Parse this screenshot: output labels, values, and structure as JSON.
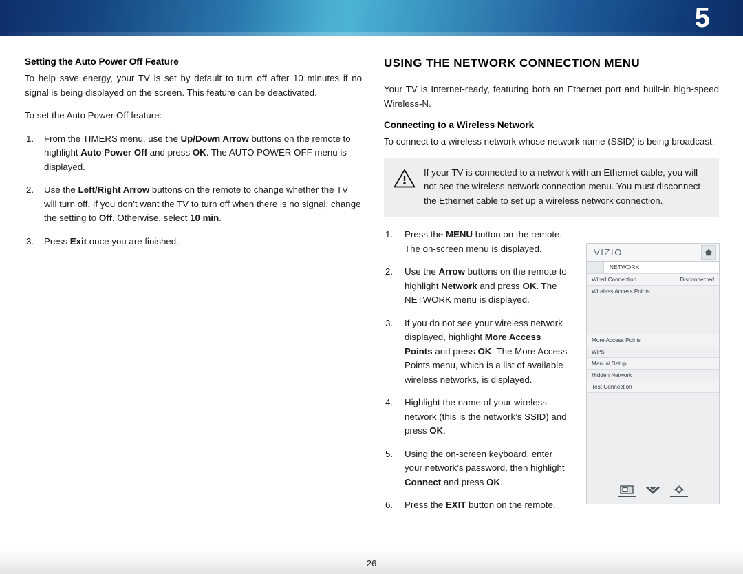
{
  "header": {
    "chapter_number": "5",
    "gradient_dark": "#0d2f6b",
    "gradient_light": "#4bb3d6"
  },
  "left_column": {
    "heading": "Setting the Auto Power Off Feature",
    "paragraph_1": "To help save energy, your TV is set by default to turn off after 10 minutes if no signal is being displayed on the screen. This feature can be deactivated.",
    "paragraph_2": "To set the Auto Power Off feature:",
    "steps": [
      {
        "parts": [
          {
            "t": "From the TIMERS menu, use the ",
            "b": false
          },
          {
            "t": "Up/Down Arrow",
            "b": true
          },
          {
            "t": " buttons on the remote to highlight ",
            "b": false
          },
          {
            "t": "Auto Power Off",
            "b": true
          },
          {
            "t": " and press ",
            "b": false
          },
          {
            "t": "OK",
            "b": true
          },
          {
            "t": ". The AUTO POWER OFF menu is displayed.",
            "b": false
          }
        ]
      },
      {
        "parts": [
          {
            "t": "Use the ",
            "b": false
          },
          {
            "t": "Left/Right Arrow",
            "b": true
          },
          {
            "t": "  buttons on the remote to change whether the TV will turn off. If you don’t want the TV to turn off when there is no signal, change the setting to ",
            "b": false
          },
          {
            "t": "Off",
            "b": true
          },
          {
            "t": ". Otherwise, select ",
            "b": false
          },
          {
            "t": "10 min",
            "b": true
          },
          {
            "t": ".",
            "b": false
          }
        ]
      },
      {
        "parts": [
          {
            "t": "Press ",
            "b": false
          },
          {
            "t": "Exit",
            "b": true
          },
          {
            "t": " once you are finished.",
            "b": false
          }
        ]
      }
    ]
  },
  "right_column": {
    "heading": "USING THE NETWORK CONNECTION MENU",
    "paragraph_1": "Your TV is Internet-ready, featuring both an Ethernet port and built-in high-speed Wireless-N.",
    "subheading": "Connecting to a Wireless Network",
    "paragraph_2": "To connect to a wireless network whose network name (SSID) is being broadcast:",
    "note": {
      "icon": "warning-triangle-icon",
      "text": "If your TV is connected to a network with an Ethernet cable, you will not see the wireless network connection menu. You must disconnect the Ethernet cable to set up a wireless network connection.",
      "background": "#eeeeee"
    },
    "steps": [
      {
        "parts": [
          {
            "t": "Press the ",
            "b": false
          },
          {
            "t": "MENU",
            "b": true
          },
          {
            "t": " button on the remote. The on-screen menu is displayed.",
            "b": false
          }
        ]
      },
      {
        "parts": [
          {
            "t": "Use the ",
            "b": false
          },
          {
            "t": "Arrow",
            "b": true
          },
          {
            "t": " buttons on the remote to highlight ",
            "b": false
          },
          {
            "t": "Network",
            "b": true
          },
          {
            "t": " and press ",
            "b": false
          },
          {
            "t": "OK",
            "b": true
          },
          {
            "t": ". The NETWORK menu is displayed.",
            "b": false
          }
        ]
      },
      {
        "parts": [
          {
            "t": "If you do not see your wireless network displayed, highlight ",
            "b": false
          },
          {
            "t": "More Access Points",
            "b": true
          },
          {
            "t": " and press ",
            "b": false
          },
          {
            "t": "OK",
            "b": true
          },
          {
            "t": ". The More Access Points menu, which is a list of available wireless networks, is displayed.",
            "b": false
          }
        ]
      },
      {
        "parts": [
          {
            "t": "Highlight the name of your wireless network (this is the network’s SSID) and press ",
            "b": false
          },
          {
            "t": "OK",
            "b": true
          },
          {
            "t": ".",
            "b": false
          }
        ]
      },
      {
        "parts": [
          {
            "t": "Using the on-screen keyboard, enter your network’s password, then highlight ",
            "b": false
          },
          {
            "t": "Connect",
            "b": true
          },
          {
            "t": " and press ",
            "b": false
          },
          {
            "t": "OK",
            "b": true
          },
          {
            "t": ".",
            "b": false
          }
        ]
      },
      {
        "parts": [
          {
            "t": "Press the ",
            "b": false
          },
          {
            "t": "EXIT",
            "b": true
          },
          {
            "t": " button on the remote.",
            "b": false
          }
        ]
      }
    ]
  },
  "tv_menu": {
    "brand": "VIZIO",
    "home_icon": "home-icon",
    "active_tab": "NETWORK",
    "rows_top": [
      {
        "label": "Wired Connection",
        "value": "Disconnected"
      },
      {
        "label": "Wireless Access Points",
        "value": ""
      }
    ],
    "rows_bottom": [
      {
        "label": "More Access Points",
        "value": ""
      },
      {
        "label": "WPS",
        "value": ""
      },
      {
        "label": "Manual Setup",
        "value": ""
      },
      {
        "label": "Hidden Network",
        "value": ""
      },
      {
        "label": "Test Connection",
        "value": ""
      }
    ],
    "bottom_icons": [
      "picture-screen-icon",
      "double-chevron-down-icon",
      "gear-icon"
    ],
    "background": "#eceef0"
  },
  "footer": {
    "page_number": "26"
  }
}
